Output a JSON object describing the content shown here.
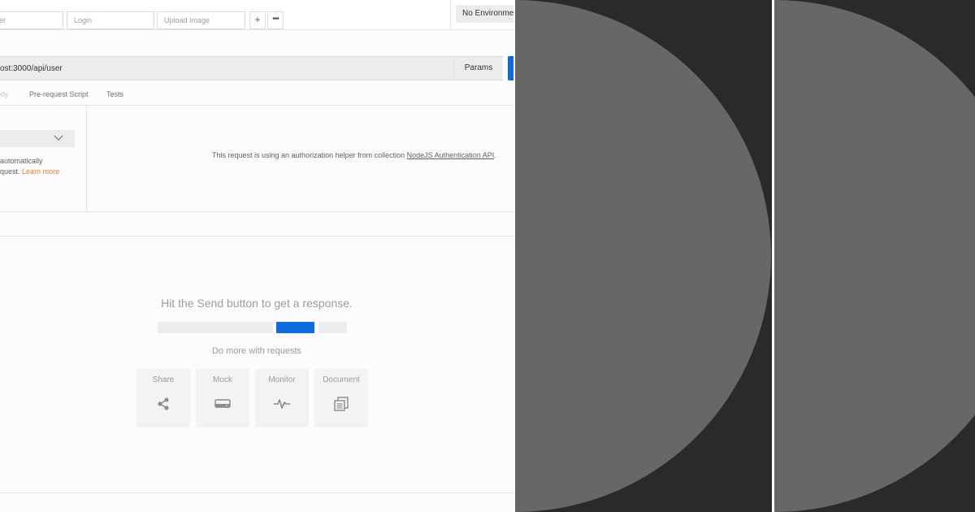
{
  "tabs": [
    {
      "label": "er"
    },
    {
      "label": "Login"
    },
    {
      "label": "Upload Image"
    }
  ],
  "tab_actions": {
    "add": "+",
    "more": "•••"
  },
  "environment": {
    "label": "No Environment"
  },
  "request": {
    "url": "ost:3000/api/user",
    "params_label": "Params"
  },
  "request_tabs": [
    {
      "label": "ody"
    },
    {
      "label": "Pre-request Script"
    },
    {
      "label": "Tests"
    }
  ],
  "authorization": {
    "note_line1": "automatically",
    "note_line2": "quest.",
    "learn_more": "Learn more",
    "helper_text": "This request is using an authorization helper from collection",
    "collection_name": "NodeJS Authentication API",
    "helper_end": "."
  },
  "response": {
    "hint": "Hit the Send button to get a response.",
    "do_more": "Do more with requests",
    "actions": [
      {
        "label": "Share",
        "icon": "share-icon"
      },
      {
        "label": "Mock",
        "icon": "mock-server-icon"
      },
      {
        "label": "Monitor",
        "icon": "monitor-pulse-icon"
      },
      {
        "label": "Document",
        "icon": "document-icon"
      }
    ]
  },
  "colors": {
    "accent_blue": "#0d6bdb",
    "link_orange": "#e0812b",
    "dark_background": "#2a2a2a",
    "circle_gray": "#676767"
  }
}
